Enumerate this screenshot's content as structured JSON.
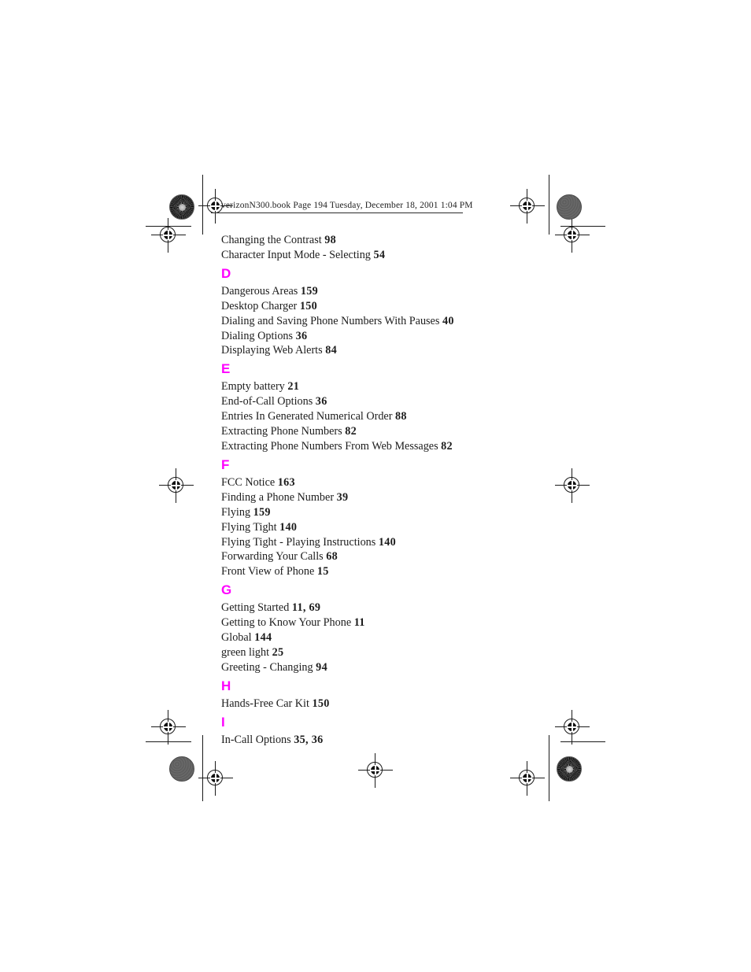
{
  "page": {
    "header_line": "verizonN300.book  Page 194  Tuesday, December 18, 2001  1:04 PM",
    "accent_color": "#ff00ff",
    "text_color": "#1c1c1c",
    "background_color": "#ffffff"
  },
  "index": {
    "groups": [
      {
        "letter": null,
        "entries": [
          {
            "title": "Changing the Contrast",
            "pages": "98"
          },
          {
            "title": "Character Input Mode - Selecting",
            "pages": "54"
          }
        ]
      },
      {
        "letter": "D",
        "entries": [
          {
            "title": "Dangerous Areas",
            "pages": "159"
          },
          {
            "title": "Desktop Charger",
            "pages": "150"
          },
          {
            "title": "Dialing and Saving Phone Numbers With Pauses",
            "pages": "40"
          },
          {
            "title": "Dialing Options",
            "pages": "36"
          },
          {
            "title": "Displaying Web Alerts",
            "pages": "84"
          }
        ]
      },
      {
        "letter": "E",
        "entries": [
          {
            "title": "Empty battery",
            "pages": "21"
          },
          {
            "title": "End-of-Call Options",
            "pages": "36"
          },
          {
            "title": "Entries In Generated Numerical Order",
            "pages": "88"
          },
          {
            "title": "Extracting Phone Numbers",
            "pages": "82"
          },
          {
            "title": "Extracting Phone Numbers From Web Messages",
            "pages": "82"
          }
        ]
      },
      {
        "letter": "F",
        "entries": [
          {
            "title": "FCC Notice",
            "pages": "163"
          },
          {
            "title": "Finding a Phone Number",
            "pages": "39"
          },
          {
            "title": "Flying",
            "pages": "159"
          },
          {
            "title": "Flying Tight",
            "pages": "140"
          },
          {
            "title": "Flying Tight - Playing Instructions",
            "pages": "140"
          },
          {
            "title": "Forwarding Your Calls",
            "pages": "68"
          },
          {
            "title": "Front View of Phone",
            "pages": "15"
          }
        ]
      },
      {
        "letter": "G",
        "entries": [
          {
            "title": "Getting Started",
            "pages": "11, 69"
          },
          {
            "title": "Getting to Know Your Phone",
            "pages": "11"
          },
          {
            "title": "Global",
            "pages": "144"
          },
          {
            "title": "green light",
            "pages": "25"
          },
          {
            "title": "Greeting - Changing",
            "pages": "94"
          }
        ]
      },
      {
        "letter": "H",
        "entries": [
          {
            "title": "Hands-Free Car Kit",
            "pages": "150"
          }
        ]
      },
      {
        "letter": "I",
        "entries": [
          {
            "title": "In-Call Options",
            "pages": "35, 36"
          }
        ]
      }
    ]
  },
  "print_marks": {
    "registration_targets": 8,
    "halftone_patches": 2,
    "density_patches": 2
  }
}
